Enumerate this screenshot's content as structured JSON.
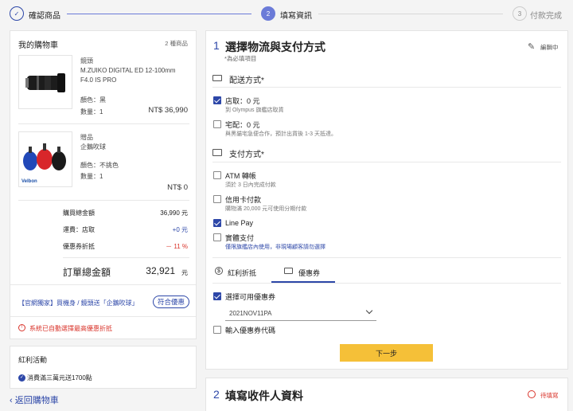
{
  "stepper": {
    "steps": [
      {
        "num": "✓",
        "label": "確認商品"
      },
      {
        "num": "2",
        "label": "填寫資訊"
      },
      {
        "num": "3",
        "label": "付款完成"
      }
    ]
  },
  "cart": {
    "title": "我的購物車",
    "count": "2 種商品",
    "items": [
      {
        "type": "鏡頭",
        "name1": "M.ZUIKO DIGITAL ED 12-100mm",
        "name2": "F4.0 IS PRO",
        "color": "顏色：黑",
        "qty": "數量：1",
        "price": "NT$ 36,990"
      },
      {
        "type": "贈品",
        "name1": "企鵝吹球",
        "name2": "",
        "color": "顏色：不挑色",
        "qty": "數量：1",
        "price": "NT$ 0"
      }
    ],
    "gift_brand": "Velbon",
    "summary": [
      {
        "label": "購買總金額",
        "value": "36,990 元",
        "color": "#222"
      },
      {
        "label": "運費：店取",
        "value": "+0 元",
        "color": "#2d47a8"
      },
      {
        "label": "優惠券折抵",
        "value": "－ 11 %",
        "color": "#d9342b"
      }
    ],
    "total_label": "訂單總金額",
    "total_value": "32,921",
    "total_unit": "元",
    "promo_text": "【官網獨家】買機身 / 鏡頭送「企鵝吹球」",
    "promo_button": "符合優惠",
    "auto_notice": "系統已自動選擇最高優惠折抵"
  },
  "bonus": {
    "title": "紅利活動",
    "item": "消費滿三萬元送1700點"
  },
  "back_link": "返回購物車",
  "section1": {
    "num": "1",
    "title": "選擇物流與支付方式",
    "required_note": "*為必填項目",
    "editing": "編輯中",
    "shipping_title": "配送方式*",
    "shipping_options": [
      {
        "title": "店取：0 元",
        "sub": "到 Olympus 旗艦店取貨",
        "checked": true
      },
      {
        "title": "宅配：0 元",
        "sub": "與黑貓宅急便合作，預計出貨後 1-3 天抵達。",
        "checked": false
      }
    ],
    "payment_title": "支付方式*",
    "payment_options": [
      {
        "title": "ATM 轉帳",
        "sub": "須於 3 日內完成付款",
        "checked": false
      },
      {
        "title": "信用卡付款",
        "sub": "購物滿 20,000 元可使用分期付款",
        "checked": false
      },
      {
        "title": "Line Pay",
        "sub": "",
        "checked": true
      },
      {
        "title": "實體支付",
        "sub": "僅限旗艦店內使用，非現場顧客請勿選擇",
        "checked": false
      }
    ],
    "tabs": [
      "紅利折抵",
      "優惠券"
    ],
    "coupon_select_label": "選擇可用優惠券",
    "coupon_selected": "2021NOV11PA",
    "coupon_input_label": "輸入優惠券代碼",
    "next_button": "下一步"
  },
  "section2": {
    "num": "2",
    "title": "填寫收件人資料",
    "status": "待填寫"
  },
  "colors": {
    "accent": "#2d47a8",
    "step_active": "#6b7bd8",
    "warn": "#d9342b",
    "button": "#f5c038"
  }
}
